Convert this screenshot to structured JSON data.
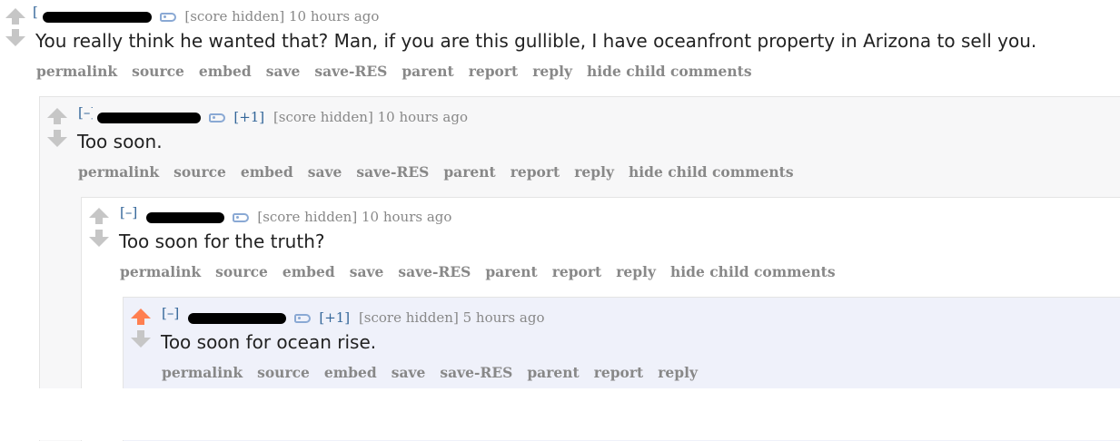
{
  "comments": [
    {
      "expand": "[–]",
      "score_plus": "",
      "score": "[score hidden]",
      "time": "10 hours ago",
      "body": "You really think he wanted that? Man, if you are this gullible, I have oceanfront property in Arizona to sell you.",
      "buttons": [
        "permalink",
        "source",
        "embed",
        "save",
        "save-RES",
        "parent",
        "report",
        "reply",
        "hide child comments"
      ]
    },
    {
      "expand": "[–]",
      "score_plus": "[+1]",
      "score": "[score hidden]",
      "time": "10 hours ago",
      "body": "Too soon.",
      "buttons": [
        "permalink",
        "source",
        "embed",
        "save",
        "save-RES",
        "parent",
        "report",
        "reply",
        "hide child comments"
      ]
    },
    {
      "expand": "[–]",
      "score_plus": "",
      "score": "[score hidden]",
      "time": "10 hours ago",
      "body": "Too soon for the truth?",
      "buttons": [
        "permalink",
        "source",
        "embed",
        "save",
        "save-RES",
        "parent",
        "report",
        "reply",
        "hide child comments"
      ]
    },
    {
      "expand": "[–]",
      "score_plus": "[+1]",
      "score": "[score hidden]",
      "time": "5 hours ago",
      "body": "Too soon for ocean rise.",
      "buttons": [
        "permalink",
        "source",
        "embed",
        "save",
        "save-RES",
        "parent",
        "report",
        "reply"
      ]
    }
  ],
  "colors": {
    "upvote_active": "#ff7f50",
    "arrow_inactive": "#c6c6c6",
    "link_blue": "#336699",
    "tagline_gray": "#888888"
  }
}
